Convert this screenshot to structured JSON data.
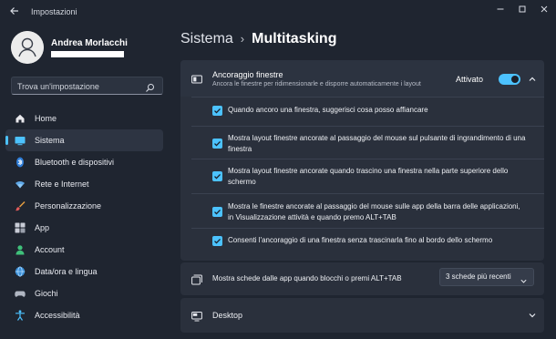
{
  "window": {
    "title": "Impostazioni",
    "controls": [
      "minimize",
      "maximize",
      "close"
    ]
  },
  "profile": {
    "name": "Andrea Morlacchi"
  },
  "search": {
    "placeholder": "Trova un'impostazione"
  },
  "sidebar": {
    "items": [
      {
        "label": "Home",
        "icon": "home-icon"
      },
      {
        "label": "Sistema",
        "icon": "system-icon",
        "active": true
      },
      {
        "label": "Bluetooth e dispositivi",
        "icon": "bluetooth-icon"
      },
      {
        "label": "Rete e Internet",
        "icon": "wifi-icon"
      },
      {
        "label": "Personalizzazione",
        "icon": "brush-icon"
      },
      {
        "label": "App",
        "icon": "apps-icon"
      },
      {
        "label": "Account",
        "icon": "account-icon"
      },
      {
        "label": "Data/ora e lingua",
        "icon": "globe-icon"
      },
      {
        "label": "Giochi",
        "icon": "gamepad-icon"
      },
      {
        "label": "Accessibilità",
        "icon": "accessibility-icon"
      }
    ]
  },
  "breadcrumb": {
    "root": "Sistema",
    "separator": "›",
    "current": "Multitasking"
  },
  "snap": {
    "title": "Ancoraggio finestre",
    "description": "Ancora le finestre per ridimensionarle e disporre automaticamente i layout",
    "status": "Attivato",
    "enabled": true,
    "options": [
      {
        "label": "Quando ancoro una finestra, suggerisci cosa posso affiancare",
        "checked": true
      },
      {
        "label": "Mostra layout finestre ancorate al passaggio del mouse sul pulsante di ingrandimento di una finestra",
        "checked": true
      },
      {
        "label": "Mostra layout finestre ancorate quando trascino una finestra nella parte superiore dello schermo",
        "checked": true
      },
      {
        "label": "Mostra le finestre ancorate al passaggio del mouse sulle app della barra delle applicazioni, in Visualizzazione attività e quando premo ALT+TAB",
        "checked": true
      },
      {
        "label": "Consenti l'ancoraggio di una finestra senza trascinarla fino al bordo dello schermo",
        "checked": true
      }
    ]
  },
  "alt_tab": {
    "label": "Mostra schede dalle app quando blocchi o premi ALT+TAB",
    "selected": "3 schede più recenti"
  },
  "desktop": {
    "label": "Desktop"
  },
  "colors": {
    "accent": "#4cc2ff",
    "background": "#1f2530",
    "card": "#2a303c"
  }
}
